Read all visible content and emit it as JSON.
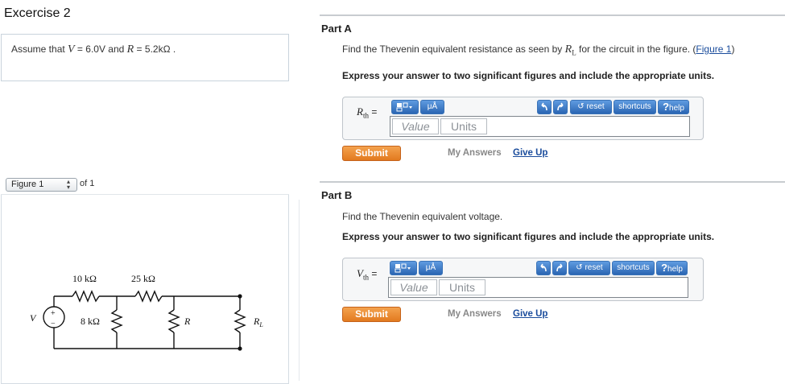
{
  "left": {
    "exercise_title": "Excercise 2",
    "given": {
      "prefix": "Assume that ",
      "v_sym": "V",
      "v_val": " = 6.0V and ",
      "r_sym": "R",
      "r_val": " = 5.2kΩ ."
    },
    "figure": {
      "selector": "Figure 1",
      "of_text": "of 1",
      "labels": {
        "r1": "10 kΩ",
        "r2": "25 kΩ",
        "r3": "8 kΩ",
        "r": "R",
        "rl": "R",
        "rl_sub": "L",
        "v": "V",
        "plus": "+",
        "minus": "−"
      }
    }
  },
  "partA": {
    "title": "Part A",
    "question_prefix": "Find the Thevenin equivalent resistance as seen by ",
    "question_sym": "R",
    "question_sub": "L",
    "question_suffix": " for the circuit in the figure. (",
    "figure_link": "Figure 1",
    "question_end": ")",
    "instruction": "Express your answer to two significant figures and include the appropriate units.",
    "var_sym": "R",
    "var_sub": "th",
    "equals": "=",
    "value_placeholder": "Value",
    "units_placeholder": "Units",
    "submit": "Submit",
    "my_answers": "My Answers",
    "give_up": "Give Up"
  },
  "partB": {
    "title": "Part B",
    "question": "Find the Thevenin equivalent voltage.",
    "instruction": "Express your answer to two significant figures and include the appropriate units.",
    "var_sym": "V",
    "var_sub": "th",
    "equals": "=",
    "value_placeholder": "Value",
    "units_placeholder": "Units",
    "submit": "Submit",
    "my_answers": "My Answers",
    "give_up": "Give Up"
  },
  "toolbar": {
    "units_btn": "μÅ",
    "reset": "reset",
    "shortcuts": "shortcuts",
    "help": "help",
    "help_mark": "?",
    "icons": [
      "templates-icon",
      "units-icon",
      "undo-icon",
      "redo-icon",
      "reset-icon",
      "help-icon"
    ]
  },
  "colors": {
    "accent": "#2b66b3",
    "submit": "#e27a1f",
    "link": "#1a4c9c"
  }
}
